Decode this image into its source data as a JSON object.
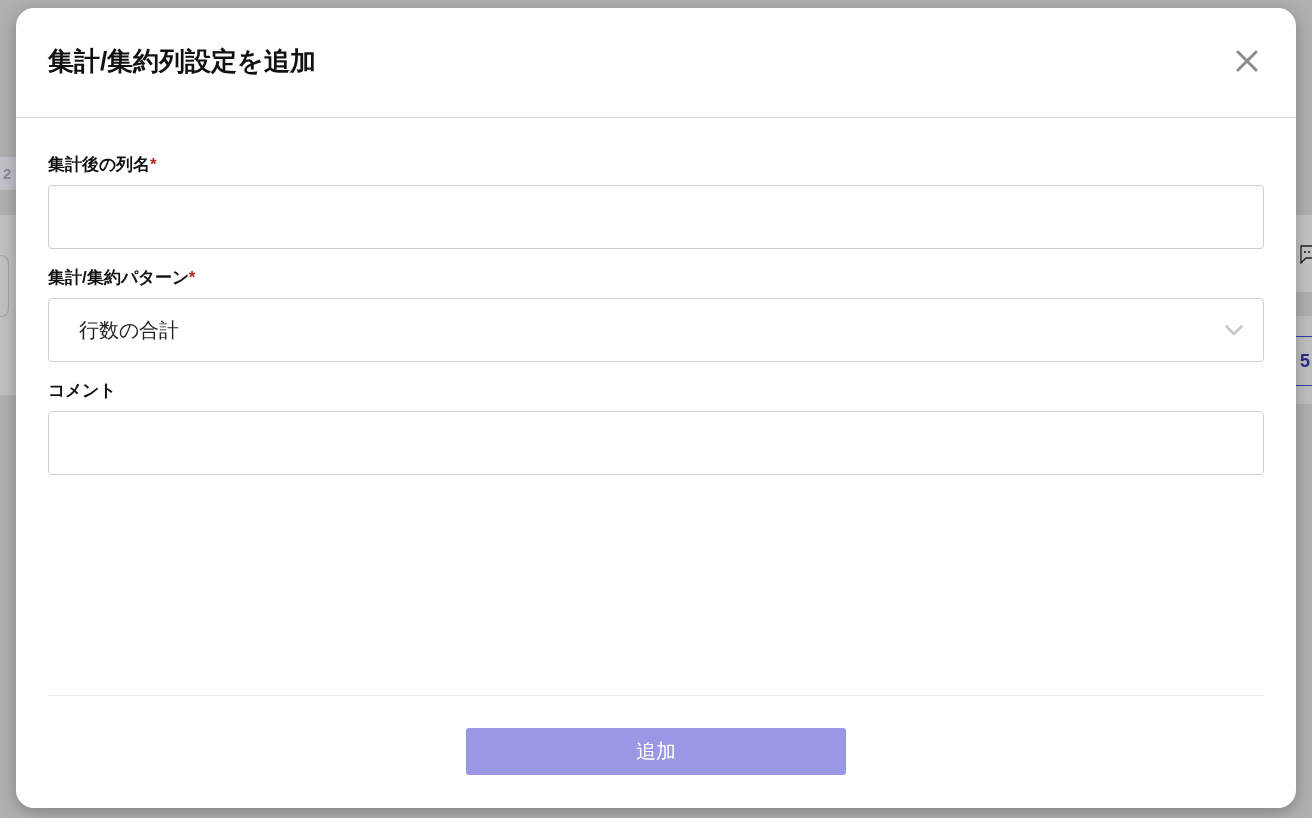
{
  "background": {
    "left_edge_text": "2",
    "right_edge_text": "5"
  },
  "dialog": {
    "title": "集計/集約列設定を追加"
  },
  "fields": [
    {
      "kind": "text",
      "label": "集計後の列名",
      "required_mark": "*"
    },
    {
      "kind": "select",
      "label": "集計/集約パターン",
      "required_mark": "*",
      "value": "行数の合計"
    },
    {
      "kind": "text",
      "label": "コメント"
    }
  ],
  "footer": {
    "submit_label": "追加",
    "disabled": true
  }
}
